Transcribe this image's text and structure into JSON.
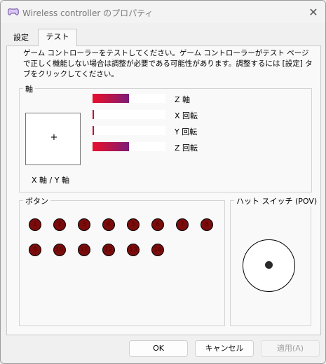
{
  "window": {
    "title": "Wireless controller のプロパティ"
  },
  "tabs": {
    "settings": "設定",
    "test": "テスト"
  },
  "description": "ゲーム コントローラーをテストしてください。ゲーム コントローラーがテスト ページで正しく機能しない場合は調整が必要である可能性があります。調整するには [設定] タブをクリックしてください。",
  "axes": {
    "group_label": "軸",
    "xy_label": "X 軸 / Y 軸",
    "bars": [
      {
        "label": "Z 軸",
        "fill": 0.5
      },
      {
        "label": "X 回転",
        "fill": 0.01
      },
      {
        "label": "Y 回転",
        "fill": 0.01
      },
      {
        "label": "Z 回転",
        "fill": 0.5
      }
    ]
  },
  "buttons": {
    "group_label": "ボタン",
    "items": [
      "1",
      "2",
      "3",
      "4",
      "5",
      "6",
      "7",
      "8",
      "9",
      "10",
      "11",
      "12",
      "13",
      "14"
    ]
  },
  "pov": {
    "group_label": "ハット スイッチ (POV)"
  },
  "footer": {
    "ok": "OK",
    "cancel": "キャンセル",
    "apply": "適用(A)"
  }
}
